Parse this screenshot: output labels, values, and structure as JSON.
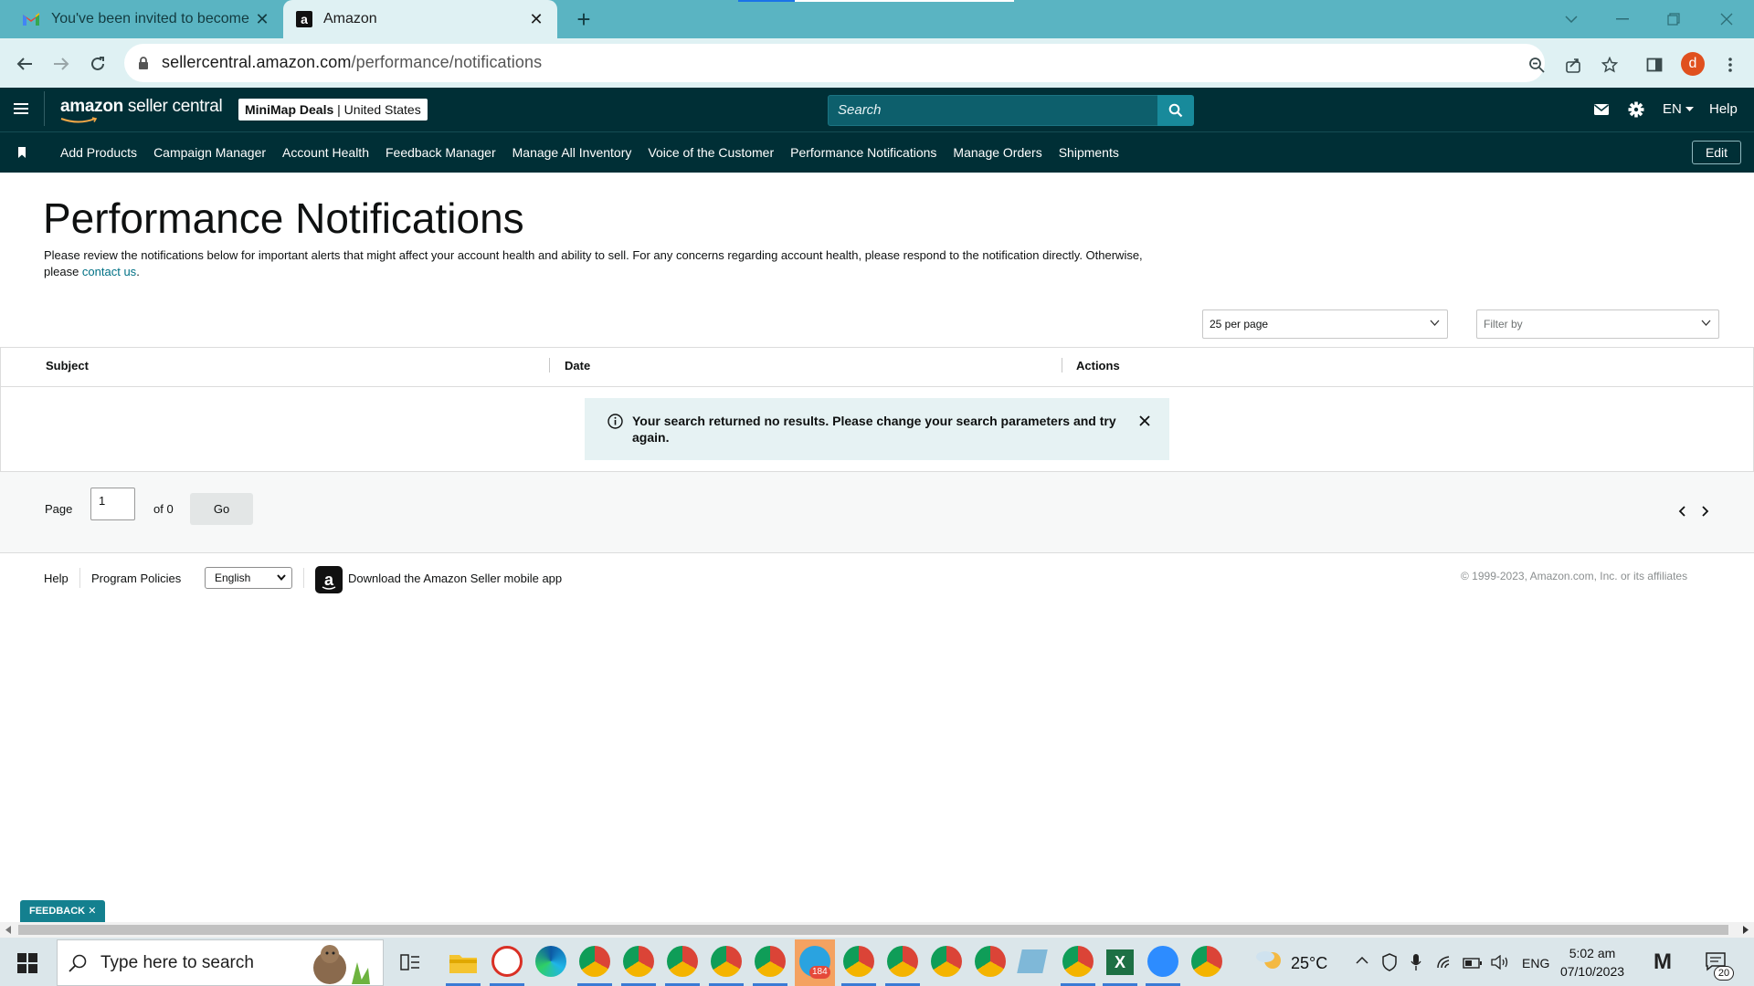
{
  "browser": {
    "tabs": [
      {
        "title": "You've been invited to become a",
        "favicon": "gmail-icon"
      },
      {
        "title": "Amazon",
        "favicon": "amazon-icon",
        "active": true
      }
    ],
    "url_host": "sellercentral.amazon.com",
    "url_path": "/performance/notifications",
    "profile_initial": "d"
  },
  "header": {
    "logo_main": "amazon",
    "logo_sub": " seller central",
    "store_name": "MiniMap Deals",
    "store_sep": " | ",
    "marketplace": "United States",
    "search_placeholder": "Search",
    "language": "EN",
    "help": "Help"
  },
  "nav": {
    "links": [
      "Add Products",
      "Campaign Manager",
      "Account Health",
      "Feedback Manager",
      "Manage All Inventory",
      "Voice of the Customer",
      "Performance Notifications",
      "Manage Orders",
      "Shipments"
    ],
    "edit": "Edit"
  },
  "page": {
    "title": "Performance Notifications",
    "description": "Please review the notifications below for important alerts that might affect your account health and ability to sell. For any concerns regarding account health, please respond to the notification directly. Otherwise, please ",
    "contact_link": "contact us",
    "description_end": "."
  },
  "controls": {
    "per_page": "25 per page",
    "filter_placeholder": "Filter by"
  },
  "table": {
    "columns": [
      "Subject",
      "Date",
      "Actions"
    ],
    "empty_message": "Your search returned no results. Please change your search parameters and try again."
  },
  "pager": {
    "page_label": "Page",
    "page_value": "1",
    "of_label": "of 0",
    "go": "Go"
  },
  "footer": {
    "help": "Help",
    "policies": "Program Policies",
    "language": "English",
    "app_text": "Download the Amazon Seller mobile app",
    "copyright": "© 1999-2023, Amazon.com, Inc. or its affiliates"
  },
  "feedback": "FEEDBACK",
  "taskbar": {
    "search_placeholder": "Type here to search",
    "weather": "25°C",
    "lang": "ENG",
    "time": "5:02 am",
    "date": "07/10/2023",
    "notification_count": "20",
    "telegram_badge": "184"
  },
  "colors": {
    "tab_strip": "#5ab4c2",
    "seller_header": "#002f36",
    "search_button": "#188a9b",
    "link": "#007185",
    "alert_bg": "#e6f2f3"
  }
}
